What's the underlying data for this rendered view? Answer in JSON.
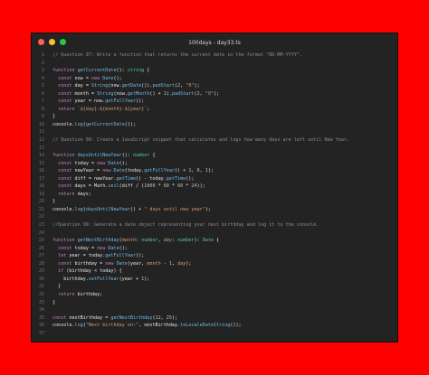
{
  "window": {
    "title": "100days - day33.ts",
    "colors": {
      "background": "#ff0000",
      "editor": "#232323"
    }
  },
  "code": {
    "lines": [
      {
        "n": "1",
        "tokens": [
          {
            "t": "// Question 97: Write a function that returns the current date in the format \"DD-MM-YYYY\".",
            "k": "comment"
          }
        ]
      },
      {
        "n": "2",
        "tokens": []
      },
      {
        "n": "3",
        "tokens": [
          {
            "t": "function ",
            "k": "kw"
          },
          {
            "t": "getCurrentDate",
            "k": "fn"
          },
          {
            "t": "(): ",
            "k": "plain"
          },
          {
            "t": "string",
            "k": "type"
          },
          {
            "t": " {",
            "k": "plain"
          }
        ]
      },
      {
        "n": "4",
        "tokens": [
          {
            "t": "  const ",
            "k": "kw"
          },
          {
            "t": "now = ",
            "k": "plain"
          },
          {
            "t": "new ",
            "k": "kw"
          },
          {
            "t": "Date",
            "k": "fn"
          },
          {
            "t": "();",
            "k": "plain"
          }
        ]
      },
      {
        "n": "5",
        "tokens": [
          {
            "t": "  const ",
            "k": "kw"
          },
          {
            "t": "day = ",
            "k": "plain"
          },
          {
            "t": "String",
            "k": "fn"
          },
          {
            "t": "(now.",
            "k": "plain"
          },
          {
            "t": "getDate",
            "k": "fn"
          },
          {
            "t": "()).",
            "k": "plain"
          },
          {
            "t": "padStart",
            "k": "fn"
          },
          {
            "t": "(",
            "k": "plain"
          },
          {
            "t": "2",
            "k": "num"
          },
          {
            "t": ", ",
            "k": "plain"
          },
          {
            "t": "\"0\"",
            "k": "str"
          },
          {
            "t": ");",
            "k": "plain"
          }
        ]
      },
      {
        "n": "6",
        "tokens": [
          {
            "t": "  const ",
            "k": "kw"
          },
          {
            "t": "month = ",
            "k": "plain"
          },
          {
            "t": "String",
            "k": "fn"
          },
          {
            "t": "(now.",
            "k": "plain"
          },
          {
            "t": "getMonth",
            "k": "fn"
          },
          {
            "t": "() + ",
            "k": "plain"
          },
          {
            "t": "1",
            "k": "num"
          },
          {
            "t": ").",
            "k": "plain"
          },
          {
            "t": "padStart",
            "k": "fn"
          },
          {
            "t": "(",
            "k": "plain"
          },
          {
            "t": "2",
            "k": "num"
          },
          {
            "t": ", ",
            "k": "plain"
          },
          {
            "t": "\"0\"",
            "k": "str"
          },
          {
            "t": ");",
            "k": "plain"
          }
        ]
      },
      {
        "n": "7",
        "tokens": [
          {
            "t": "  const ",
            "k": "kw"
          },
          {
            "t": "year = now.",
            "k": "plain"
          },
          {
            "t": "getFullYear",
            "k": "fn"
          },
          {
            "t": "();",
            "k": "plain"
          }
        ]
      },
      {
        "n": "8",
        "tokens": [
          {
            "t": "  return ",
            "k": "kw"
          },
          {
            "t": "`${day}-${month}-${year}`",
            "k": "str"
          },
          {
            "t": ";",
            "k": "plain"
          }
        ]
      },
      {
        "n": "9",
        "tokens": [
          {
            "t": "}",
            "k": "plain"
          }
        ]
      },
      {
        "n": "10",
        "tokens": [
          {
            "t": "console.",
            "k": "plain"
          },
          {
            "t": "log",
            "k": "fn"
          },
          {
            "t": "(",
            "k": "plain"
          },
          {
            "t": "getCurrentDate",
            "k": "fn"
          },
          {
            "t": "());",
            "k": "plain"
          }
        ]
      },
      {
        "n": "11",
        "tokens": []
      },
      {
        "n": "12",
        "tokens": [
          {
            "t": "// Question 98: Create a JavaScript snippet that calculates and logs how many days are left until New Year.",
            "k": "comment"
          }
        ]
      },
      {
        "n": "13",
        "tokens": []
      },
      {
        "n": "14",
        "tokens": [
          {
            "t": "function ",
            "k": "kw"
          },
          {
            "t": "daysUntilNewYear",
            "k": "fn"
          },
          {
            "t": "(): ",
            "k": "plain"
          },
          {
            "t": "number",
            "k": "type"
          },
          {
            "t": " {",
            "k": "plain"
          }
        ]
      },
      {
        "n": "15",
        "tokens": [
          {
            "t": "  const ",
            "k": "kw"
          },
          {
            "t": "today = ",
            "k": "plain"
          },
          {
            "t": "new ",
            "k": "kw"
          },
          {
            "t": "Date",
            "k": "fn"
          },
          {
            "t": "();",
            "k": "plain"
          }
        ]
      },
      {
        "n": "16",
        "tokens": [
          {
            "t": "  const ",
            "k": "kw"
          },
          {
            "t": "newYear = ",
            "k": "plain"
          },
          {
            "t": "new ",
            "k": "kw"
          },
          {
            "t": "Date",
            "k": "fn"
          },
          {
            "t": "(today.",
            "k": "plain"
          },
          {
            "t": "getFullYear",
            "k": "fn"
          },
          {
            "t": "() + ",
            "k": "plain"
          },
          {
            "t": "1",
            "k": "num"
          },
          {
            "t": ", ",
            "k": "plain"
          },
          {
            "t": "0",
            "k": "num"
          },
          {
            "t": ", ",
            "k": "plain"
          },
          {
            "t": "1",
            "k": "num"
          },
          {
            "t": ");",
            "k": "plain"
          }
        ]
      },
      {
        "n": "17",
        "tokens": [
          {
            "t": "  const ",
            "k": "kw"
          },
          {
            "t": "diff = newYear.",
            "k": "plain"
          },
          {
            "t": "getTime",
            "k": "fn"
          },
          {
            "t": "() - today.",
            "k": "plain"
          },
          {
            "t": "getTime",
            "k": "fn"
          },
          {
            "t": "();",
            "k": "plain"
          }
        ]
      },
      {
        "n": "18",
        "tokens": [
          {
            "t": "  const ",
            "k": "kw"
          },
          {
            "t": "days = Math.",
            "k": "plain"
          },
          {
            "t": "ceil",
            "k": "fn"
          },
          {
            "t": "(diff / (",
            "k": "plain"
          },
          {
            "t": "1000",
            "k": "num"
          },
          {
            "t": " * ",
            "k": "plain"
          },
          {
            "t": "60",
            "k": "num"
          },
          {
            "t": " * ",
            "k": "plain"
          },
          {
            "t": "60",
            "k": "num"
          },
          {
            "t": " * ",
            "k": "plain"
          },
          {
            "t": "24",
            "k": "num"
          },
          {
            "t": "));",
            "k": "plain"
          }
        ]
      },
      {
        "n": "19",
        "tokens": [
          {
            "t": "  return ",
            "k": "kw"
          },
          {
            "t": "days;",
            "k": "plain"
          }
        ]
      },
      {
        "n": "20",
        "tokens": [
          {
            "t": "}",
            "k": "plain"
          }
        ]
      },
      {
        "n": "21",
        "tokens": [
          {
            "t": "console.",
            "k": "plain"
          },
          {
            "t": "log",
            "k": "fn"
          },
          {
            "t": "(",
            "k": "plain"
          },
          {
            "t": "daysUntilNewYear",
            "k": "fn"
          },
          {
            "t": "() + ",
            "k": "plain"
          },
          {
            "t": "\" days until new year\"",
            "k": "str"
          },
          {
            "t": ");",
            "k": "plain"
          }
        ]
      },
      {
        "n": "22",
        "tokens": []
      },
      {
        "n": "23",
        "tokens": [
          {
            "t": "//Question 99: Generate a date object representing your next birthday and log it to the console.",
            "k": "comment"
          }
        ]
      },
      {
        "n": "24",
        "tokens": []
      },
      {
        "n": "25",
        "tokens": [
          {
            "t": "function ",
            "k": "kw"
          },
          {
            "t": "getNextBirthday",
            "k": "fn"
          },
          {
            "t": "(",
            "k": "plain"
          },
          {
            "t": "month",
            "k": "param"
          },
          {
            "t": ": ",
            "k": "plain"
          },
          {
            "t": "number",
            "k": "type"
          },
          {
            "t": ", ",
            "k": "plain"
          },
          {
            "t": "day",
            "k": "param"
          },
          {
            "t": ": ",
            "k": "plain"
          },
          {
            "t": "number",
            "k": "type"
          },
          {
            "t": "): ",
            "k": "plain"
          },
          {
            "t": "Date",
            "k": "type"
          },
          {
            "t": " {",
            "k": "plain"
          }
        ]
      },
      {
        "n": "26",
        "tokens": [
          {
            "t": "  const ",
            "k": "kw"
          },
          {
            "t": "today = ",
            "k": "plain"
          },
          {
            "t": "new ",
            "k": "kw"
          },
          {
            "t": "Date",
            "k": "fn"
          },
          {
            "t": "();",
            "k": "plain"
          }
        ]
      },
      {
        "n": "27",
        "tokens": [
          {
            "t": "  let ",
            "k": "kw"
          },
          {
            "t": "year = today.",
            "k": "plain"
          },
          {
            "t": "getFullYear",
            "k": "fn"
          },
          {
            "t": "();",
            "k": "plain"
          }
        ]
      },
      {
        "n": "28",
        "tokens": [
          {
            "t": "  const ",
            "k": "kw"
          },
          {
            "t": "birthday = ",
            "k": "plain"
          },
          {
            "t": "new ",
            "k": "kw"
          },
          {
            "t": "Date",
            "k": "fn"
          },
          {
            "t": "(year, ",
            "k": "plain"
          },
          {
            "t": "month",
            "k": "param"
          },
          {
            "t": " - ",
            "k": "plain"
          },
          {
            "t": "1",
            "k": "num"
          },
          {
            "t": ", ",
            "k": "plain"
          },
          {
            "t": "day",
            "k": "param"
          },
          {
            "t": ");",
            "k": "plain"
          }
        ]
      },
      {
        "n": "29",
        "tokens": [
          {
            "t": "  if ",
            "k": "kw"
          },
          {
            "t": "(birthday < today) {",
            "k": "plain"
          }
        ]
      },
      {
        "n": "30",
        "tokens": [
          {
            "t": "    birthday.",
            "k": "plain"
          },
          {
            "t": "setFullYear",
            "k": "fn"
          },
          {
            "t": "(year + ",
            "k": "plain"
          },
          {
            "t": "1",
            "k": "num"
          },
          {
            "t": ");",
            "k": "plain"
          }
        ]
      },
      {
        "n": "31",
        "tokens": [
          {
            "t": "  }",
            "k": "plain"
          }
        ]
      },
      {
        "n": "32",
        "tokens": [
          {
            "t": "  return ",
            "k": "kw"
          },
          {
            "t": "birthday;",
            "k": "plain"
          }
        ]
      },
      {
        "n": "33",
        "tokens": [
          {
            "t": "}",
            "k": "plain"
          }
        ]
      },
      {
        "n": "34",
        "tokens": []
      },
      {
        "n": "35",
        "tokens": [
          {
            "t": "const ",
            "k": "kw"
          },
          {
            "t": "nextBirthday = ",
            "k": "plain"
          },
          {
            "t": "getNextBirthday",
            "k": "fn"
          },
          {
            "t": "(",
            "k": "plain"
          },
          {
            "t": "12",
            "k": "num"
          },
          {
            "t": ", ",
            "k": "plain"
          },
          {
            "t": "25",
            "k": "num"
          },
          {
            "t": ");",
            "k": "plain"
          }
        ]
      },
      {
        "n": "36",
        "tokens": [
          {
            "t": "console.",
            "k": "plain"
          },
          {
            "t": "log",
            "k": "fn"
          },
          {
            "t": "(",
            "k": "plain"
          },
          {
            "t": "\"Next birthday on:\"",
            "k": "str"
          },
          {
            "t": ", nextBirthday.",
            "k": "plain"
          },
          {
            "t": "toLocaleDateString",
            "k": "fn"
          },
          {
            "t": "());",
            "k": "plain"
          }
        ]
      },
      {
        "n": "37",
        "tokens": []
      }
    ]
  }
}
